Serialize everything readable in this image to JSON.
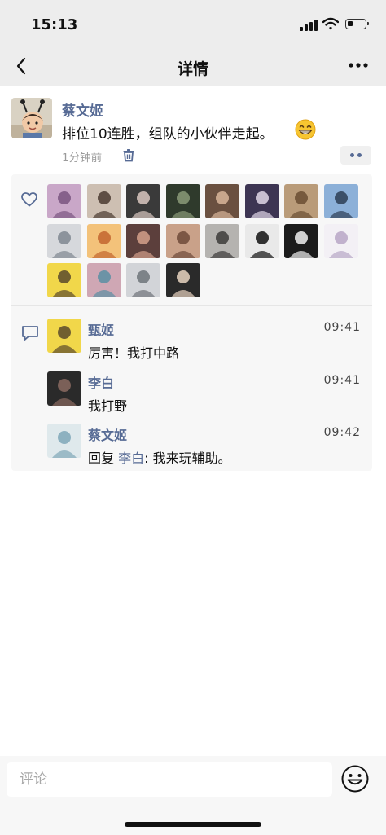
{
  "status_bar": {
    "time": "15:13"
  },
  "nav": {
    "title": "详情"
  },
  "post": {
    "author": "蔡文姬",
    "text": "排位10连胜，组队的小伙伴走起。",
    "emoji": "grinning-face",
    "time": "1分钟前"
  },
  "likes": {
    "avatars": [
      {
        "name": "like-avatar-1",
        "bg": "#c9a7c8",
        "fg": "#7a5580"
      },
      {
        "name": "like-avatar-2",
        "bg": "#cdbfb2",
        "fg": "#4a3a30"
      },
      {
        "name": "like-avatar-3",
        "bg": "#3a3a3a",
        "fg": "#d9c7c0"
      },
      {
        "name": "like-avatar-4",
        "bg": "#2f3a2c",
        "fg": "#8a9a78"
      },
      {
        "name": "like-avatar-5",
        "bg": "#6a5040",
        "fg": "#d8b59a"
      },
      {
        "name": "like-avatar-6",
        "bg": "#3d3553",
        "fg": "#e0d7e8"
      },
      {
        "name": "like-avatar-7",
        "bg": "#b99b79",
        "fg": "#6a4e33"
      },
      {
        "name": "like-avatar-8",
        "bg": "#8cb0d8",
        "fg": "#2d3e55"
      },
      {
        "name": "like-avatar-9",
        "bg": "#d6d8dc",
        "fg": "#7f8790"
      },
      {
        "name": "like-avatar-10",
        "bg": "#f3c27a",
        "fg": "#c2652f"
      },
      {
        "name": "like-avatar-11",
        "bg": "#5c3f3c",
        "fg": "#d3a08a"
      },
      {
        "name": "like-avatar-12",
        "bg": "#c9a189",
        "fg": "#6e4a3a"
      },
      {
        "name": "like-avatar-13",
        "bg": "#b5b3b0",
        "fg": "#3c3b3a"
      },
      {
        "name": "like-avatar-14",
        "bg": "#e9e9e9",
        "fg": "#111111"
      },
      {
        "name": "like-avatar-15",
        "bg": "#1b1b1b",
        "fg": "#f0f0f0"
      },
      {
        "name": "like-avatar-16",
        "bg": "#f3f0f5",
        "fg": "#b7a6c6"
      },
      {
        "name": "like-avatar-17",
        "bg": "#f1d74a",
        "fg": "#5b4a2b"
      },
      {
        "name": "like-avatar-18",
        "bg": "#cfa7b4",
        "fg": "#5b8fa3"
      },
      {
        "name": "like-avatar-19",
        "bg": "#d2d4d8",
        "fg": "#6f747a"
      },
      {
        "name": "like-avatar-20",
        "bg": "#2a2a2a",
        "fg": "#e8d3c0"
      }
    ]
  },
  "comments": [
    {
      "name": "甄姬",
      "time": "09:41",
      "text": "厉害！我打中路",
      "avatar_bg": "#f1d74a",
      "avatar_fg": "#5b4a2b"
    },
    {
      "name": "李白",
      "time": "09:41",
      "text": "我打野",
      "avatar_bg": "#2a2a2a",
      "avatar_fg": "#8a6a60"
    },
    {
      "name": "蔡文姬",
      "time": "09:42",
      "reply_prefix": "回复",
      "reply_to": "李白",
      "reply_sep": ": ",
      "text": "我来玩辅助。",
      "avatar_bg": "#dfe9ec",
      "avatar_fg": "#7fa7b8"
    }
  ],
  "input": {
    "placeholder": "评论"
  },
  "colors": {
    "link": "#576b95",
    "bar_bg": "#ededed",
    "panel_bg": "#f7f7f7"
  },
  "icons": {
    "back": "chevron-left-icon",
    "more": "more-dots-icon",
    "trash": "trash-icon",
    "like": "heart-icon",
    "comment": "comment-bubble-icon",
    "emoji_button": "smiley-icon"
  }
}
